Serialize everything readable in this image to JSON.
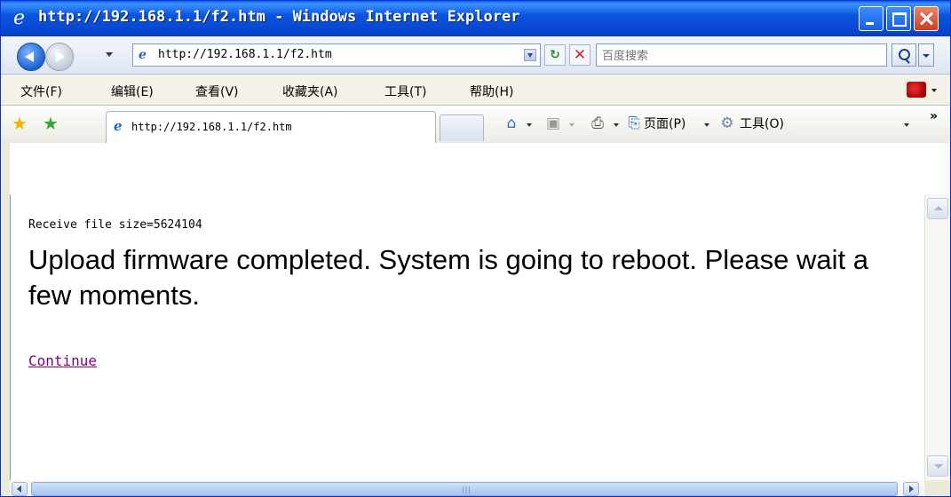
{
  "window": {
    "title": "http://192.168.1.1/f2.htm - Windows Internet Explorer"
  },
  "address_bar": {
    "url": "http://192.168.1.1/f2.htm",
    "search_placeholder": "百度搜索"
  },
  "menu": {
    "items": [
      "文件(F)",
      "编辑(E)",
      "查看(V)",
      "收藏夹(A)",
      "工具(T)",
      "帮助(H)"
    ]
  },
  "tab": {
    "label": "http://192.168.1.1/f2.htm"
  },
  "command_bar": {
    "page_label": "页面(P)",
    "tools_label": "工具(O)"
  },
  "content": {
    "receive_text": "Receive file size=5624104",
    "message": "Upload firmware completed.  System is going to reboot. Please wait a few moments.",
    "continue_link": "Continue"
  },
  "colors": {
    "titlebar": "#0a54de",
    "visited_link": "#800080"
  }
}
